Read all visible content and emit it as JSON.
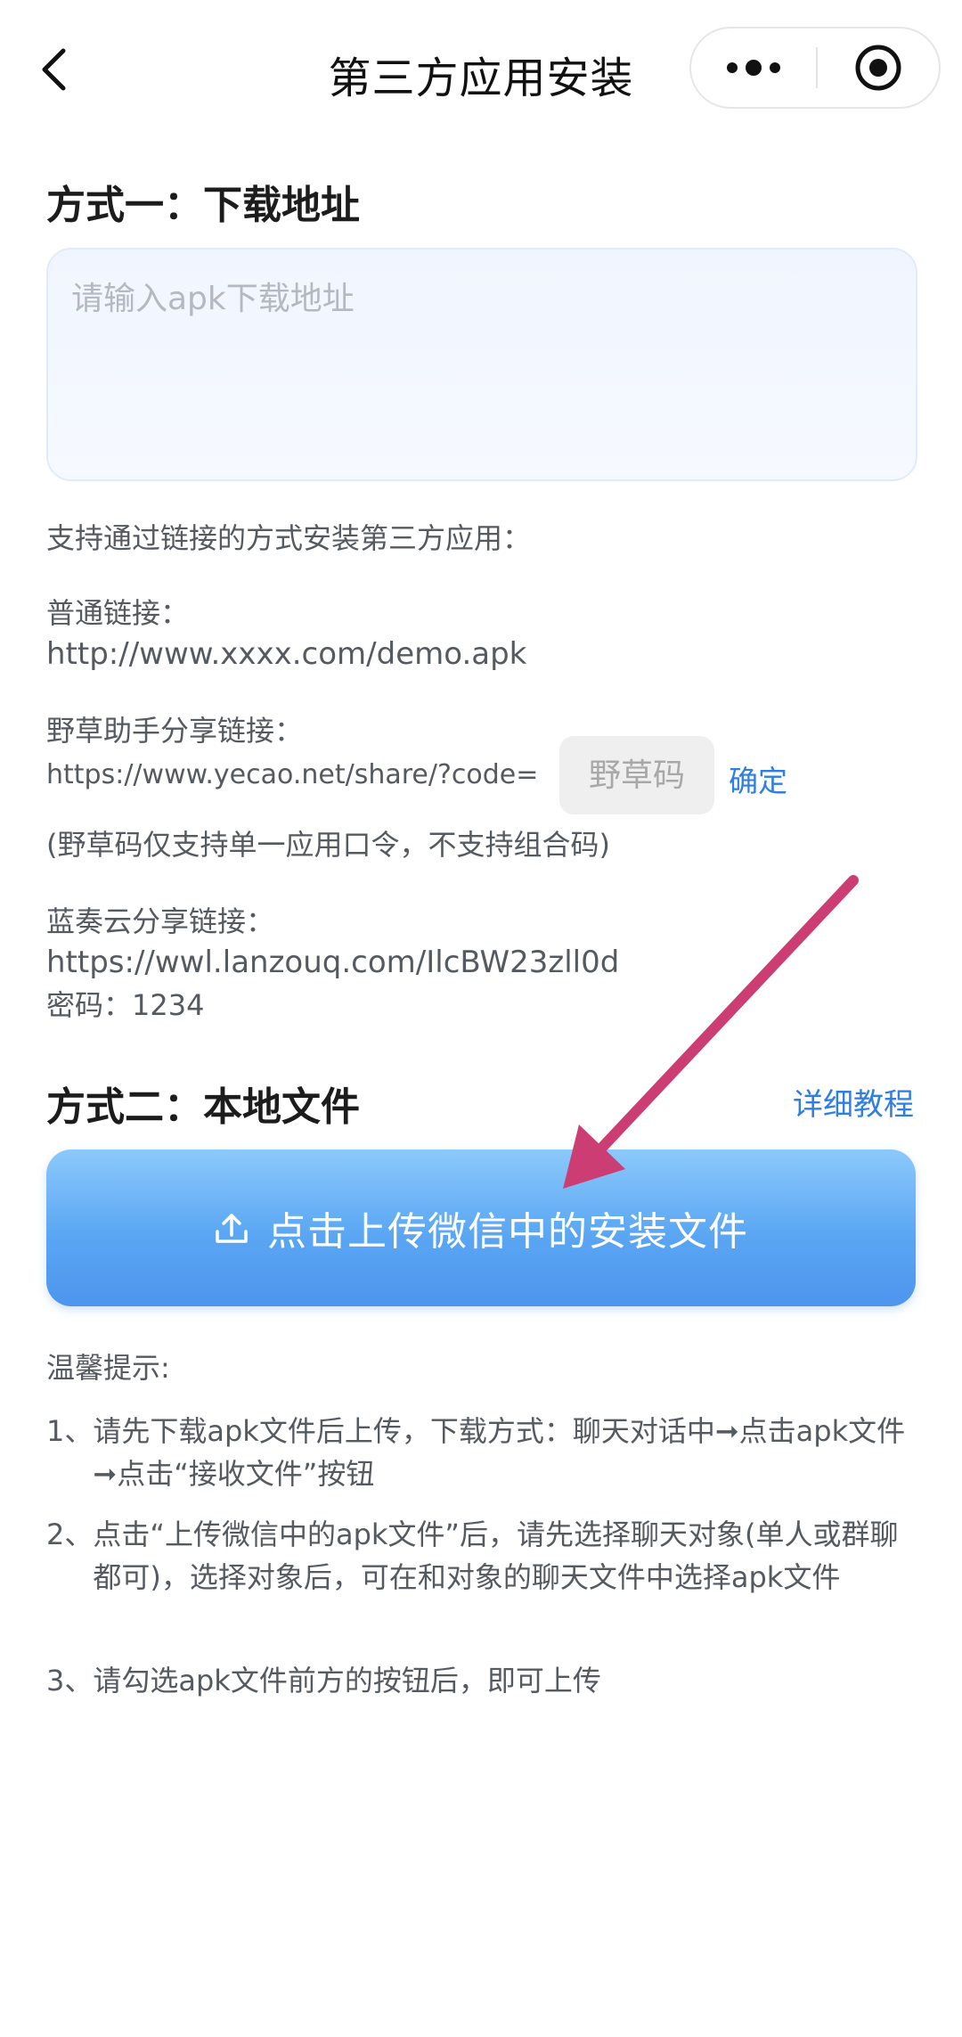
{
  "navbar": {
    "title": "第三方应用安装",
    "back_icon": "chevron-left-icon",
    "more_icon": "more-dots-icon",
    "close_icon": "target-circle-icon"
  },
  "method1": {
    "heading": "方式一：下载地址",
    "url_placeholder": "请输入apk下载地址",
    "url_value": "",
    "support_text": "支持通过链接的方式安装第三方应用：",
    "normal_link_label": "普通链接：",
    "normal_link_url": "http://www.xxxx.com/demo.apk",
    "yecao_label": "野草助手分享链接：",
    "yecao_url_prefix": "https://www.yecao.net/share/?code=",
    "yecao_code_placeholder": "野草码",
    "confirm_label": "确定",
    "yecao_note": "(野草码仅支持单一应用口令，不支持组合码)",
    "lanzou_label": "蓝奏云分享链接：",
    "lanzou_url": "https://wwl.lanzouq.com/IlcBW23zll0d",
    "lanzou_password": "密码：1234"
  },
  "method2": {
    "heading": "方式二：本地文件",
    "tutorial_link": "详细教程",
    "upload_label": "点击上传微信中的安装文件",
    "upload_icon": "upload-icon"
  },
  "tips": {
    "title": "温馨提示:",
    "items": [
      {
        "num": "1、",
        "text": "请先下载apk文件后上传，下载方式：聊天对话中➞点击apk文件➞点击“接收文件”按钮"
      },
      {
        "num": "2、",
        "text": "点击“上传微信中的apk文件”后，请先选择聊天对象(单人或群聊都可)，选择对象后，可在和对象的聊天文件中选择apk文件"
      },
      {
        "num": "3、",
        "text": "请勾选apk文件前方的按钮后，即可上传"
      }
    ]
  },
  "colors": {
    "accent_blue": "#2f7ee0",
    "button_gradient_top": "#8cc9fb",
    "button_gradient_bottom": "#4d95ee",
    "annotation_arrow": "#cc3d73"
  }
}
